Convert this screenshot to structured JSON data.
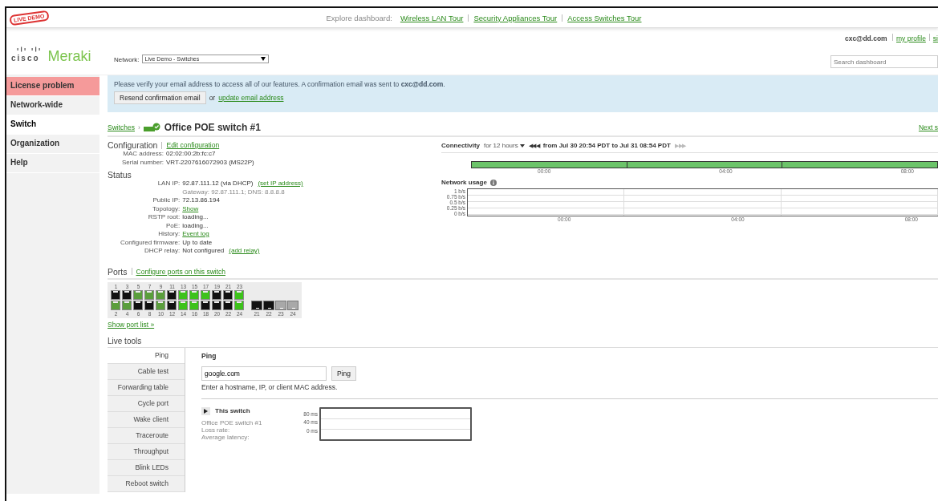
{
  "live_badge": "LIVE DEMO",
  "explore": {
    "label": "Explore dashboard:",
    "links": [
      "Wireless LAN Tour",
      "Security Appliances Tour",
      "Access Switches Tour"
    ]
  },
  "logo": {
    "brand": "cisco",
    "product": "Meraki"
  },
  "network": {
    "label": "Network:",
    "value": "Live Demo - Switches"
  },
  "user": {
    "email": "cxc@dd.com",
    "links": [
      "my profile",
      "si"
    ]
  },
  "search": {
    "placeholder": "Search dashboard"
  },
  "sidebar": {
    "items": [
      {
        "label": "License problem",
        "kind": "alert",
        "selected": false
      },
      {
        "label": "Network-wide",
        "kind": "normal",
        "selected": false
      },
      {
        "label": "Switch",
        "kind": "normal",
        "selected": true
      },
      {
        "label": "Organization",
        "kind": "normal",
        "selected": false
      },
      {
        "label": "Help",
        "kind": "normal",
        "selected": false
      }
    ]
  },
  "banner": {
    "message": "Please verify your email address to access all of our features. A confirmation email was sent to **cxc@dd.com**.",
    "button": "Resend confirmation email",
    "or": "or",
    "link": "update email address"
  },
  "breadcrumb": {
    "parent": "Switches",
    "sep": "›",
    "title": "Office POE switch #1",
    "next": "Next s"
  },
  "configuration": {
    "heading": "Configuration",
    "link": "Edit configuration",
    "rows": [
      {
        "label": "MAC address:",
        "value": "02:02:00:2b:fc:c7"
      },
      {
        "label": "Serial number:",
        "value": "VRT-2207616072903  (MS22P)"
      }
    ]
  },
  "status": {
    "heading": "Status",
    "rows": [
      {
        "label": "LAN IP:",
        "value": "92.87.111.12 (via DHCP)",
        "link": "(set IP address)",
        "sub": "Gateway: 92.87.111.1; DNS: 8.8.8.8"
      },
      {
        "label": "Public IP:",
        "value": "72.13.86.194"
      },
      {
        "label": "Topology:",
        "link": "Show"
      },
      {
        "label": "RSTP root:",
        "value": "loading..."
      },
      {
        "label": "PoE:",
        "value": "loading..."
      },
      {
        "label": "History:",
        "link": "Event log"
      },
      {
        "label": "Configured firmware:",
        "value": "Up to date"
      },
      {
        "label": "DHCP relay:",
        "value": "Not configured",
        "link": "(add relay)"
      }
    ]
  },
  "connectivity": {
    "heading": "Connectivity",
    "range": "for 12 hours",
    "back": "◀◀ ◀",
    "period": "from Jul 30 20:54 PDT to Jul 31 08:54 PDT",
    "forward": "▶ ▶▶",
    "ticks": [
      "00:00",
      "04:00",
      "08:00"
    ]
  },
  "network_usage": {
    "heading": "Network usage",
    "yticks": [
      "1 b/s",
      "0.75 b/s",
      "0.5 b/s",
      "0.25 b/s",
      "0 b/s"
    ],
    "xticks": [
      "00:00",
      "04:00",
      "08:00"
    ]
  },
  "ports": {
    "heading": "Ports",
    "link": "Configure ports on this switch",
    "more": "Show port list »",
    "top": [
      {
        "n": "1",
        "color": "#111111"
      },
      {
        "n": "3",
        "color": "#111111"
      },
      {
        "n": "5",
        "color": "#5a9e3c"
      },
      {
        "n": "7",
        "color": "#5a9e3c"
      },
      {
        "n": "9",
        "color": "#5a9e3c"
      },
      {
        "n": "11",
        "color": "#111111"
      },
      {
        "n": "13",
        "color": "#3dc21b"
      },
      {
        "n": "15",
        "color": "#3dc21b"
      },
      {
        "n": "17",
        "color": "#3dc21b"
      },
      {
        "n": "19",
        "color": "#111111"
      },
      {
        "n": "21",
        "color": "#111111"
      },
      {
        "n": "23",
        "color": "#3dc21b"
      }
    ],
    "bottom": [
      {
        "n": "2",
        "color": "#5a9e3c"
      },
      {
        "n": "4",
        "color": "#5a9e3c"
      },
      {
        "n": "6",
        "color": "#111111"
      },
      {
        "n": "8",
        "color": "#111111"
      },
      {
        "n": "10",
        "color": "#5a9e3c"
      },
      {
        "n": "12",
        "color": "#111111"
      },
      {
        "n": "14",
        "color": "#3dc21b"
      },
      {
        "n": "16",
        "color": "#3dc21b"
      },
      {
        "n": "18",
        "color": "#111111"
      },
      {
        "n": "20",
        "color": "#111111"
      },
      {
        "n": "22",
        "color": "#111111"
      },
      {
        "n": "24",
        "color": "#3dc21b"
      }
    ],
    "uplinks": [
      {
        "n": "21",
        "color": "#111111"
      },
      {
        "n": "22",
        "color": "#111111"
      },
      {
        "n": "23",
        "color": "#a8a8a8"
      },
      {
        "n": "24",
        "color": "#a8a8a8"
      }
    ]
  },
  "live_tools": {
    "heading": "Live tools",
    "tabs": [
      {
        "label": "Ping",
        "selected": true
      },
      {
        "label": "Cable test",
        "selected": false
      },
      {
        "label": "Forwarding table",
        "selected": false
      },
      {
        "label": "Cycle port",
        "selected": false
      },
      {
        "label": "Wake client",
        "selected": false
      },
      {
        "label": "Traceroute",
        "selected": false
      },
      {
        "label": "Throughput",
        "selected": false
      },
      {
        "label": "Blink LEDs",
        "selected": false
      },
      {
        "label": "Reboot switch",
        "selected": false
      }
    ],
    "ping": {
      "title": "Ping",
      "value": "google.com",
      "button": "Ping",
      "hint": "Enter a hostname, IP, or client MAC address.",
      "target": "This switch",
      "lines": [
        "Office POE switch #1",
        "Loss rate:",
        "Average latency:"
      ],
      "yticks": [
        "80 ms",
        "40 ms",
        "0 ms"
      ]
    }
  }
}
